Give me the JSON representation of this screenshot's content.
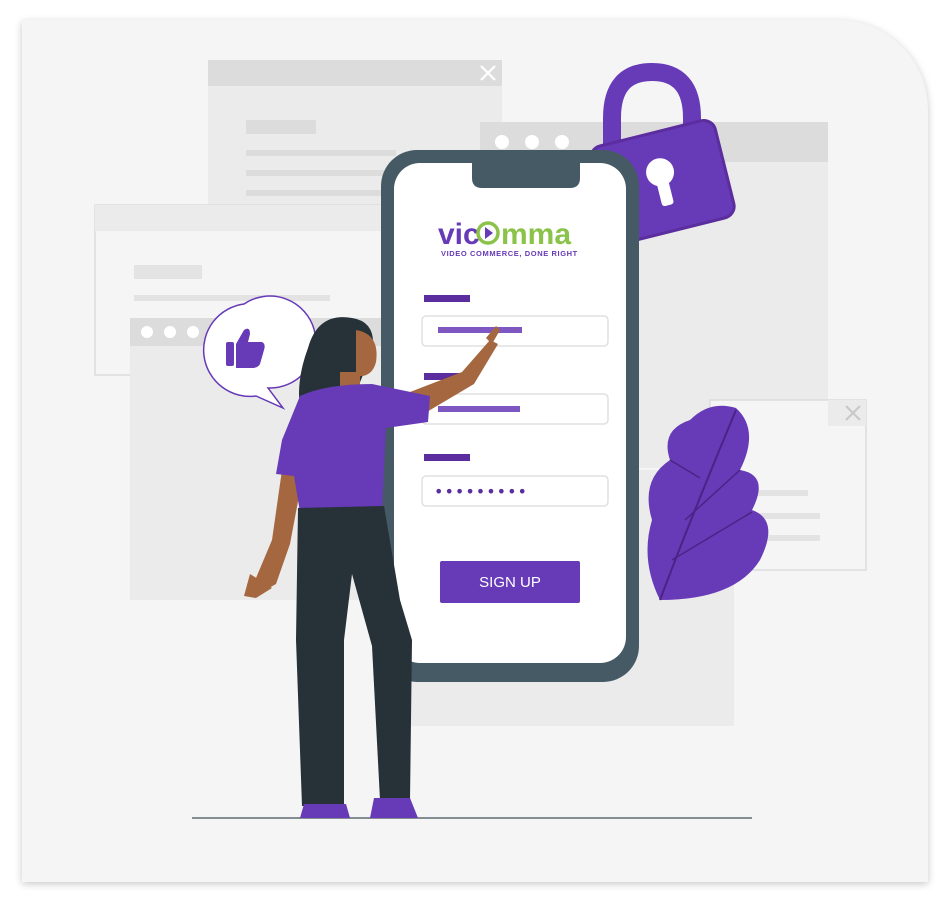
{
  "brand": {
    "name_prefix": "vic",
    "name_suffix": "mma",
    "tagline": "VIDEO COMMERCE, DONE RIGHT"
  },
  "signup_form": {
    "password_mask": "•••••••••",
    "submit_label": "SIGN UP"
  },
  "icons": [
    "close-icon",
    "close-icon",
    "lock-icon",
    "thumbs-up-icon",
    "leaf-illustration"
  ],
  "colors": {
    "accent": "#673ab7",
    "accent_dark": "#5b2d9e",
    "brand_green": "#8bc34a",
    "phone_frame": "#455a64",
    "figure_dark": "#263238",
    "skin": "#a5673f",
    "panel_gray": "#ebebeb",
    "panel_bar": "#dcdcdc"
  }
}
